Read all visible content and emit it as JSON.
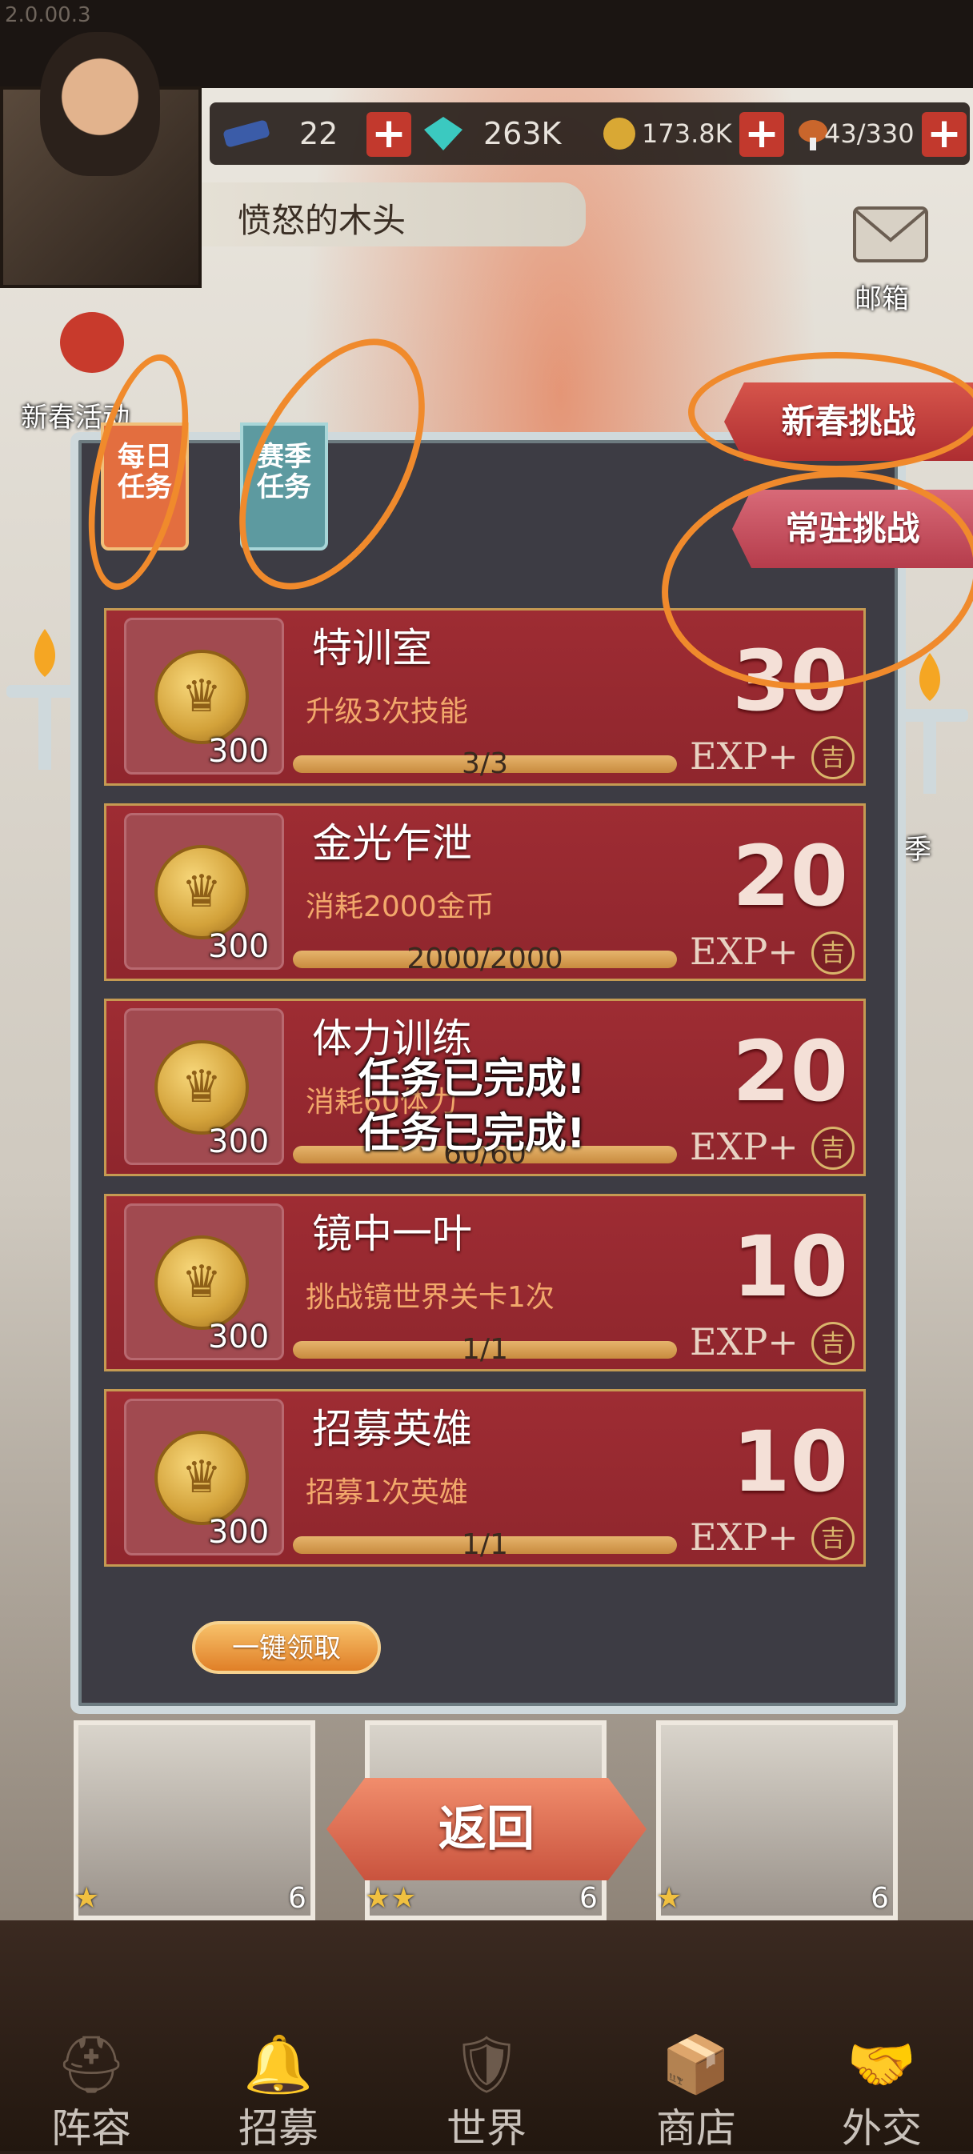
{
  "version": "2.0.00.3",
  "resources": {
    "gems_small": "22",
    "diamond": "263K",
    "gold": "173.8K",
    "stamina": "43/330"
  },
  "player": {
    "name": "愤怒的木头"
  },
  "sidebar": {
    "mail": "邮箱",
    "new_year_event": "新春活动",
    "season": "季"
  },
  "challenge_ribbons": [
    "新春挑战",
    "常驻挑战"
  ],
  "tabs": {
    "daily": "每日\n任务",
    "season": "赛季\n任务"
  },
  "tasks": [
    {
      "name": "特训室",
      "desc": "升级3次技能",
      "reward": "300",
      "progress_text": "3/3",
      "progress": 1.0,
      "exp": "30",
      "exp_label": "EXP+",
      "badge": "吉"
    },
    {
      "name": "金光乍泄",
      "desc": "消耗2000金币",
      "reward": "300",
      "progress_text": "2000/2000",
      "progress": 1.0,
      "exp": "20",
      "exp_label": "EXP+",
      "badge": "吉"
    },
    {
      "name": "体力训练",
      "desc": "消耗60体力",
      "reward": "300",
      "progress_text": "60/60",
      "progress": 1.0,
      "exp": "20",
      "exp_label": "EXP+",
      "badge": "吉"
    },
    {
      "name": "镜中一叶",
      "desc": "挑战镜世界关卡1次",
      "reward": "300",
      "progress_text": "1/1",
      "progress": 1.0,
      "exp": "10",
      "exp_label": "EXP+",
      "badge": "吉"
    },
    {
      "name": "招募英雄",
      "desc": "招募1次英雄",
      "reward": "300",
      "progress_text": "1/1",
      "progress": 1.0,
      "exp": "10",
      "exp_label": "EXP+",
      "badge": "吉"
    }
  ],
  "toasts": [
    "任务已完成!",
    "任务已完成!"
  ],
  "claim_all": "一键领取",
  "back": "返回",
  "hero_cards": [
    {
      "stars": "★",
      "cost": "6"
    },
    {
      "stars": "★★",
      "cost": "6"
    },
    {
      "stars": "★",
      "cost": "6"
    }
  ],
  "nav": [
    "阵容",
    "招募",
    "世界",
    "商店",
    "外交"
  ],
  "colors": {
    "accent_orange": "#f08a2c",
    "card_red": "#9e2c33",
    "exp_text": "#f4e0d7"
  }
}
